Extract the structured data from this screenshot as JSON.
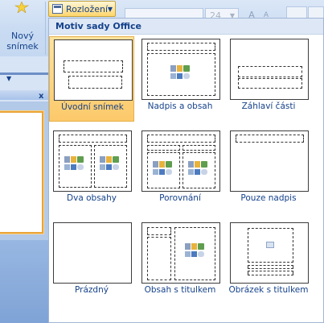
{
  "ribbon": {
    "new_slide_line1": "Nový",
    "new_slide_line2": "snímek",
    "layout_button": "Rozložení",
    "font_size": "24",
    "grow_font": "A",
    "shrink_font": "A"
  },
  "left_pane": {
    "close": "x"
  },
  "gallery": {
    "header": "Motiv sady Office",
    "items": [
      {
        "label": "Úvodní snímek",
        "selected": true
      },
      {
        "label": "Nadpis a obsah",
        "selected": false
      },
      {
        "label": "Záhlaví části",
        "selected": false
      },
      {
        "label": "Dva obsahy",
        "selected": false
      },
      {
        "label": "Porovnání",
        "selected": false
      },
      {
        "label": "Pouze nadpis",
        "selected": false
      },
      {
        "label": "Prázdný",
        "selected": false
      },
      {
        "label": "Obsah s titulkem",
        "selected": false
      },
      {
        "label": "Obrázek s titulkem",
        "selected": false
      }
    ]
  }
}
